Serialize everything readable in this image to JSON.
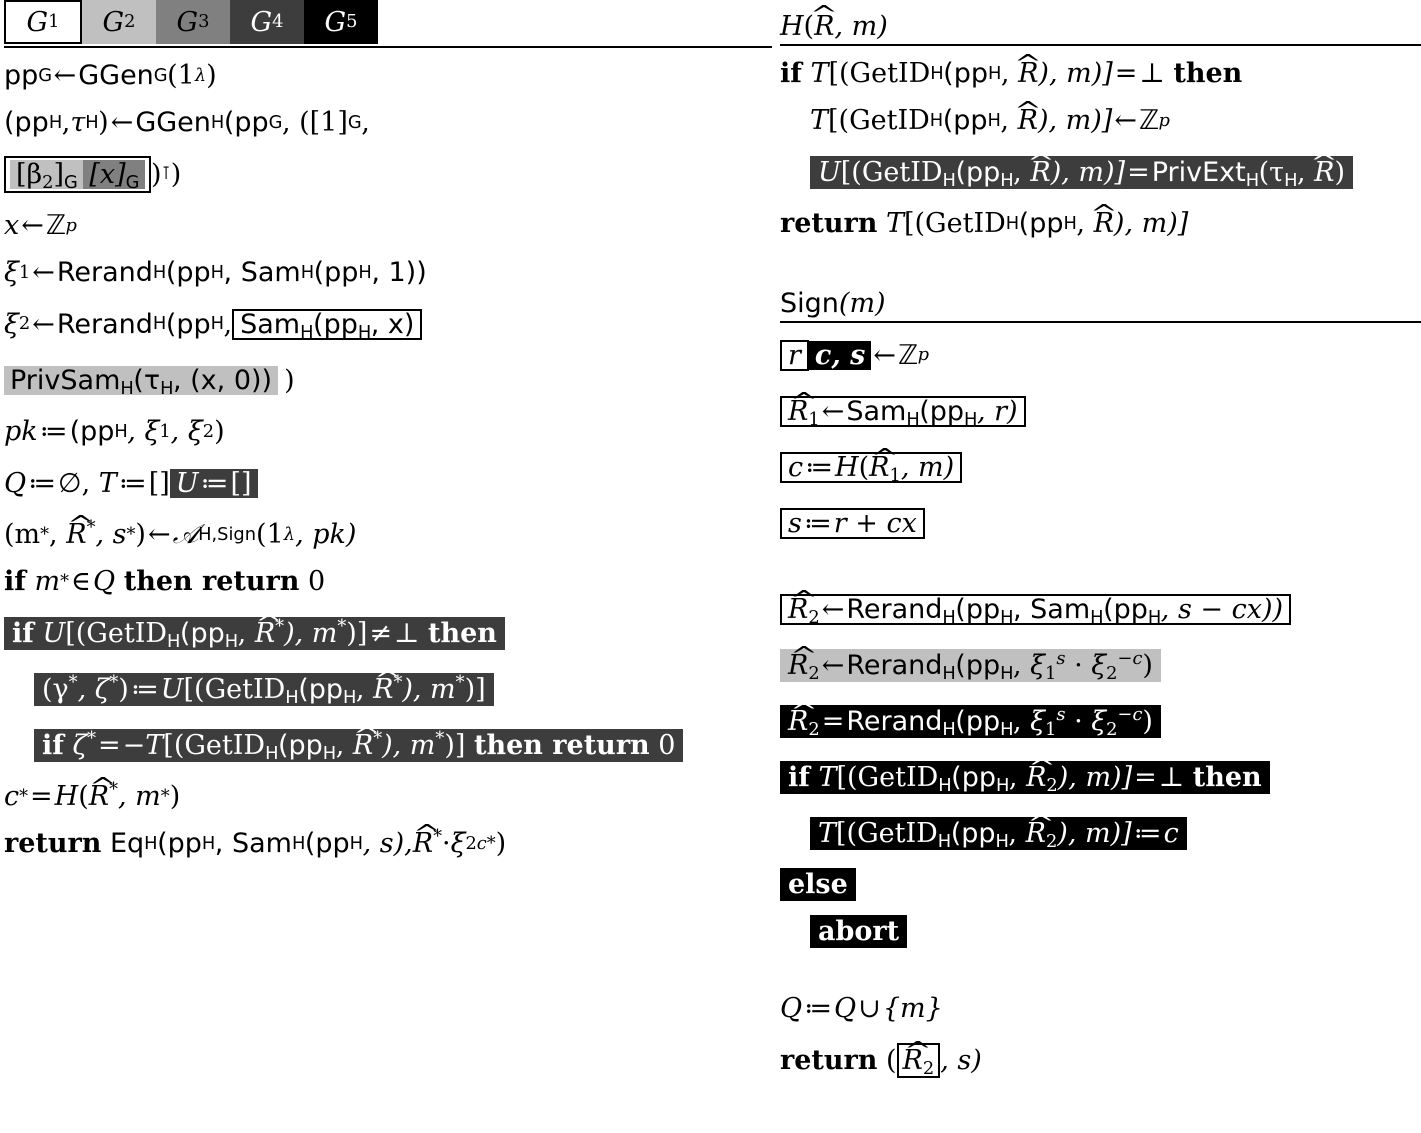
{
  "figure": {
    "kind": "cryptographic-game-pseudocode",
    "columns": 2,
    "game_labels": [
      "G1",
      "G2",
      "G3",
      "G4",
      "G5"
    ],
    "shading": {
      "G1": "#ffffff",
      "G2": "#c0c0c0",
      "G3": "#808080",
      "G4": "#3d3d3d",
      "G5": "#000000"
    }
  },
  "games_header": {
    "g1": "G",
    "g1sub": "1",
    "g2": "G",
    "g2sub": "2",
    "g3": "G",
    "g3sub": "3",
    "g4": "G",
    "g4sub": "4",
    "g5": "G",
    "g5sub": "5"
  },
  "main": {
    "l1": {
      "lhs": "pp",
      "lhs_sub": "G",
      "arrow": "←",
      "fn": "GGen",
      "fn_sub": "G",
      "arg": "(1",
      "arg_sup": "λ",
      "close": ")"
    },
    "l2": {
      "open": "(pp",
      "sub1": "H",
      "comma": ", ",
      "tau": "τ",
      "tau_sub": "H",
      "close1": ")",
      "arrow": "←",
      "fn": "GGen",
      "fn_sub": "H",
      "args": "(pp",
      "args_sub": "G",
      "tail": ", ([1]",
      "tail_sub": "G",
      "tail2": " ,"
    },
    "l3": {
      "beta": "[β",
      "beta_sub": "2",
      "beta_close": "]",
      "beta_g": "G",
      "x": "[x]",
      "x_g": "G",
      "trans": ")",
      "trans_sup": "⊺",
      "end": ")"
    },
    "l4": {
      "lhs": "x",
      "arrow": "←",
      "rhs": "ℤ",
      "rhs_sub": "p"
    },
    "l5": {
      "lhs": "ξ",
      "lhs_sub": "1",
      "arrow": "←",
      "fn": "Rerand",
      "fn_sub": "H",
      "a1": "(pp",
      "a1_sub": "H",
      "a2": ", Sam",
      "a2_sub": "H",
      "a3": "(pp",
      "a3_sub": "H",
      "a4": ", 1))"
    },
    "l6": {
      "lhs": "ξ",
      "lhs_sub": "2",
      "arrow": "←",
      "fn": "Rerand",
      "fn_sub": "H",
      "a1": "(pp",
      "a1_sub": "H",
      "comma": ",",
      "box": "Sam",
      "box_sub": "H",
      "box_args": "(pp",
      "box_args_sub": "H",
      "box_tail": ", x)"
    },
    "l7": {
      "box": "PrivSam",
      "box_sub": "H",
      "box_args": "(τ",
      "box_args_sub": "H",
      "box_tail": ", (x, 0))",
      "after": ")"
    },
    "l8": {
      "lhs": "pk",
      "assign": "≔",
      "rhs": "(pp",
      "rhs_sub": "H",
      "x1": ", ξ",
      "x1_sub": "1",
      "x2": ", ξ",
      "x2_sub": "2",
      "close": ")"
    },
    "l9": {
      "q": "Q",
      "assign1": "≔",
      "empty": "∅",
      "comma": ",",
      "t": "T",
      "assign2": "≔",
      "tval": "[]",
      "u": "U",
      "assign3": "≔",
      "uval": "[]"
    },
    "l10": {
      "open": "(m",
      "m_sup": "*",
      "r": "R",
      "r_sup": "*",
      "s": ", s",
      "s_sup": "*",
      "close": ")",
      "arrow": "←",
      "adv": "𝒜",
      "adv_sup": "H,Sign",
      "args": "(1",
      "args_sup": "λ",
      "tail": ", pk)"
    },
    "l11": {
      "if": "if",
      "m": "m",
      "m_sup": "*",
      "in": "∈",
      "q": "Q",
      "then": "then return",
      "zero": "0"
    },
    "l12": {
      "if": "if",
      "u": "U",
      "open": "[(GetID",
      "sub": "H",
      "args": "(pp",
      "args_sub": "H",
      "r": "R",
      "r_sup": "*",
      "mid": "), m",
      "m_sup": "*",
      "close": ")]",
      "neq": "≠",
      "bot": "⊥",
      "then": "then"
    },
    "l13": {
      "open": "(γ",
      "g_sup": "*",
      "comma": ", ζ",
      "z_sup": "*",
      "close1": ")",
      "assign": "≔",
      "u": "U",
      "open2": "[(GetID",
      "sub": "H",
      "args": "(pp",
      "args_sub": "H",
      "r": "R",
      "r_sup": "*",
      "mid": "), m",
      "m_sup": "*",
      "close": ")]"
    },
    "l14": {
      "if": "if",
      "z": "ζ",
      "z_sup": "*",
      "eq": "=",
      "neg": "−",
      "t": "T",
      "open": "[(GetID",
      "sub": "H",
      "args": "(pp",
      "args_sub": "H",
      "r": "R",
      "r_sup": "*",
      "mid": "), m",
      "m_sup": "*",
      "close": ")]",
      "then": "then return",
      "zero": "0"
    },
    "l15": {
      "c": "c",
      "c_sup": "*",
      "eq": "=",
      "h": "H",
      "open": "(",
      "r": "R",
      "r_sup": "*",
      "mid": ", m",
      "m_sup": "*",
      "close": ")"
    },
    "l16": {
      "return": "return",
      "eq": "Eq",
      "eq_sub": "H",
      "a1": "(pp",
      "a1_sub": "H",
      "a2": ", Sam",
      "a2_sub": "H",
      "a3": "(pp",
      "a3_sub": "H",
      "a4": ", s), ",
      "r": "R",
      "r_sup": "*",
      "dot": " · ",
      "xi": "ξ",
      "xi_sub": "2",
      "xi_sup": "c*",
      "close": ")"
    }
  },
  "oracle_h": {
    "title_h": "H",
    "title_open": "(",
    "title_r": "R",
    "title_tail": ", m)",
    "l1": {
      "if": "if",
      "t": "T",
      "open": "[(GetID",
      "sub": "H",
      "args": "(pp",
      "args_sub": "H",
      "r": "R",
      "mid": "), m)]",
      "eq": "=",
      "bot": "⊥",
      "then": "then"
    },
    "l2": {
      "t": "T",
      "open": "[(GetID",
      "sub": "H",
      "args": "(pp",
      "args_sub": "H",
      "r": "R",
      "mid": "), m)]",
      "arrow": "←",
      "z": "ℤ",
      "z_sub": "p"
    },
    "l3": {
      "u": "U",
      "open": "[(GetID",
      "sub": "H",
      "args": "(pp",
      "args_sub": "H",
      "r": "R",
      "mid": "), m)]",
      "eq": "=",
      "fn": "PrivExt",
      "fn_sub": "H",
      "fargs": "(τ",
      "fargs_sub": "H",
      "fr": "R",
      "close": ")"
    },
    "l4": {
      "return": "return",
      "t": "T",
      "open": "[(GetID",
      "sub": "H",
      "args": "(pp",
      "args_sub": "H",
      "r": "R",
      "mid": "), m)]"
    }
  },
  "oracle_sign": {
    "title_s": "Sign",
    "title_arg": "(m)",
    "l1": {
      "r": "r",
      "cs": "c, s",
      "arrow": "←",
      "z": "ℤ",
      "z_sub": "p"
    },
    "l2": {
      "r": "R",
      "r_sub": "1",
      "arrow": "←",
      "fn": "Sam",
      "fn_sub": "H",
      "args": "(pp",
      "args_sub": "H",
      "tail": ", r)"
    },
    "l3": {
      "c": "c",
      "assign": "≔",
      "h": "H",
      "open": "(",
      "r": "R",
      "r_sub": "1",
      "tail": ", m)"
    },
    "l4": {
      "s": "s",
      "assign": "≔",
      "rhs": "r + cx"
    },
    "l5": {
      "r": "R",
      "r_sub": "2",
      "arrow": "←",
      "fn": "Rerand",
      "fn_sub": "H",
      "a1": "(pp",
      "a1_sub": "H",
      "a2": ", Sam",
      "a2_sub": "H",
      "a3": "(pp",
      "a3_sub": "H",
      "a4": ", s − cx))"
    },
    "l6": {
      "r": "R",
      "r_sub": "2",
      "arrow": "←",
      "fn": "Rerand",
      "fn_sub": "H",
      "a1": "(pp",
      "a1_sub": "H",
      "comma": ", ",
      "xi1": "ξ",
      "xi1_sub": "1",
      "xi1_sup": "s",
      "dot": " · ",
      "xi2": "ξ",
      "xi2_sub": "2",
      "xi2_sup": "−c",
      "close": ")"
    },
    "l7": {
      "r": "R",
      "r_sub": "2",
      "eq": "=",
      "fn": "Rerand",
      "fn_sub": "H",
      "a1": "(pp",
      "a1_sub": "H",
      "comma": ", ",
      "xi1": "ξ",
      "xi1_sub": "1",
      "xi1_sup": "s",
      "dot": " · ",
      "xi2": "ξ",
      "xi2_sub": "2",
      "xi2_sup": "−c",
      "close": ")"
    },
    "l8": {
      "if": "if",
      "t": "T",
      "open": "[(GetID",
      "sub": "H",
      "args": "(pp",
      "args_sub": "H",
      "r": "R",
      "r_sub": "2",
      "mid": "), m)]",
      "eq": "=",
      "bot": "⊥",
      "then": "then"
    },
    "l9": {
      "t": "T",
      "open": "[(GetID",
      "sub": "H",
      "args": "(pp",
      "args_sub": "H",
      "r": "R",
      "r_sub": "2",
      "mid": "), m)]",
      "assign": "≔",
      "c": "c"
    },
    "l10": {
      "else": "else"
    },
    "l11": {
      "abort": "abort"
    },
    "l12": {
      "q": "Q",
      "assign": "≔",
      "q2": "Q",
      "cup": "∪",
      "set": "{m}"
    },
    "l13": {
      "return": "return",
      "open": "(",
      "r": "R",
      "r_sub": "2",
      "tail": ", s)"
    }
  }
}
